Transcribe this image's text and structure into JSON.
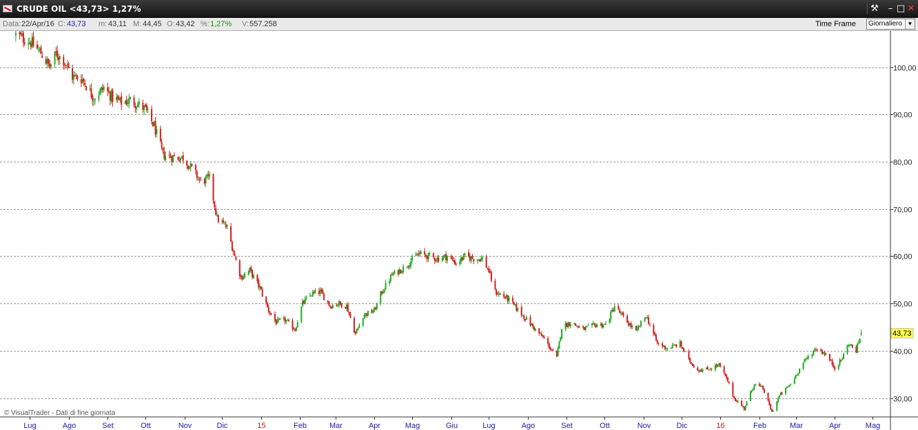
{
  "window": {
    "title": "CRUDE OIL <43,73> 1,27%",
    "pin_icon": "pin-icon",
    "minimize_icon": "minimize-icon",
    "maximize_icon": "maximize-icon",
    "close_icon": "close-icon"
  },
  "infobar": {
    "date_label": "Data:",
    "date_value": "22/Apr/16",
    "close_label": "C:",
    "close_value": "43,73",
    "min_label": "m:",
    "min_value": "43,11",
    "max_label": "M:",
    "max_value": "44,45",
    "open_label": "O:",
    "open_value": "43,42",
    "pct_label": "%:",
    "pct_value": "1,27%",
    "vol_label": "V:",
    "vol_value": "557.258",
    "timeframe_label": "Time Frame",
    "timeframe_value": "Giornaliero"
  },
  "credit": "© VisualTrader - Dati di fine giornata",
  "colors": {
    "up_candle": "#1fa81f",
    "down_candle": "#d41b1b",
    "gridline": "#9a9a9a",
    "month_label": "#1a1aa8",
    "year_label": "#cc1111",
    "last_price_bg": "#ffff55"
  },
  "chart_data": {
    "type": "candlestick",
    "series_name": "CRUDE OIL",
    "timeframe": "Giornaliero",
    "y_ticks": [
      "30,00",
      "40,00",
      "50,00",
      "60,00",
      "70,00",
      "80,00",
      "90,00",
      "100,00"
    ],
    "y_tick_values": [
      30,
      40,
      50,
      60,
      70,
      80,
      90,
      100
    ],
    "ylim": [
      26,
      107.5
    ],
    "x_ticks": [
      {
        "label": "Lug",
        "date": "2014-07-01"
      },
      {
        "label": "Ago",
        "date": "2014-08-01"
      },
      {
        "label": "Set",
        "date": "2014-09-01"
      },
      {
        "label": "Ott",
        "date": "2014-10-01"
      },
      {
        "label": "Nov",
        "date": "2014-11-01"
      },
      {
        "label": "Dic",
        "date": "2014-12-01"
      },
      {
        "label": "15",
        "date": "2015-01-01",
        "year": true
      },
      {
        "label": "Feb",
        "date": "2015-02-01"
      },
      {
        "label": "Mar",
        "date": "2015-03-01"
      },
      {
        "label": "Apr",
        "date": "2015-04-01"
      },
      {
        "label": "Mag",
        "date": "2015-05-01"
      },
      {
        "label": "Giu",
        "date": "2015-06-01"
      },
      {
        "label": "Lug",
        "date": "2015-07-01"
      },
      {
        "label": "Ago",
        "date": "2015-08-01"
      },
      {
        "label": "Set",
        "date": "2015-09-01"
      },
      {
        "label": "Ott",
        "date": "2015-10-01"
      },
      {
        "label": "Nov",
        "date": "2015-11-01"
      },
      {
        "label": "Dic",
        "date": "2015-12-01"
      },
      {
        "label": "16",
        "date": "2016-01-01",
        "year": true
      },
      {
        "label": "Feb",
        "date": "2016-02-01"
      },
      {
        "label": "Mar",
        "date": "2016-03-01"
      },
      {
        "label": "Apr",
        "date": "2016-04-01"
      },
      {
        "label": "Mag",
        "date": "2016-05-01"
      }
    ],
    "close_path": [
      [
        "2014-06-20",
        106.8
      ],
      [
        "2014-07-01",
        105.5
      ],
      [
        "2014-07-10",
        103.0
      ],
      [
        "2014-07-17",
        100.0
      ],
      [
        "2014-07-22",
        102.8
      ],
      [
        "2014-07-28",
        101.5
      ],
      [
        "2014-08-04",
        98.0
      ],
      [
        "2014-08-12",
        97.5
      ],
      [
        "2014-08-21",
        93.5
      ],
      [
        "2014-08-29",
        95.6
      ],
      [
        "2014-09-05",
        93.5
      ],
      [
        "2014-09-12",
        92.5
      ],
      [
        "2014-09-19",
        93.0
      ],
      [
        "2014-09-26",
        92.0
      ],
      [
        "2014-10-01",
        91.0
      ],
      [
        "2014-10-08",
        87.5
      ],
      [
        "2014-10-15",
        81.5
      ],
      [
        "2014-10-22",
        81.0
      ],
      [
        "2014-10-31",
        80.8
      ],
      [
        "2014-11-07",
        78.5
      ],
      [
        "2014-11-14",
        75.8
      ],
      [
        "2014-11-21",
        76.5
      ],
      [
        "2014-11-27",
        68.0
      ],
      [
        "2014-12-05",
        66.0
      ],
      [
        "2014-12-11",
        60.0
      ],
      [
        "2014-12-16",
        55.5
      ],
      [
        "2014-12-23",
        57.0
      ],
      [
        "2014-12-31",
        53.3
      ],
      [
        "2015-01-07",
        48.5
      ],
      [
        "2015-01-13",
        46.0
      ],
      [
        "2015-01-20",
        46.5
      ],
      [
        "2015-01-28",
        44.5
      ],
      [
        "2015-02-03",
        50.0
      ],
      [
        "2015-02-10",
        52.0
      ],
      [
        "2015-02-17",
        52.5
      ],
      [
        "2015-02-25",
        49.5
      ],
      [
        "2015-03-03",
        50.0
      ],
      [
        "2015-03-10",
        49.5
      ],
      [
        "2015-03-17",
        43.5
      ],
      [
        "2015-03-23",
        47.5
      ],
      [
        "2015-04-01",
        48.5
      ],
      [
        "2015-04-07",
        52.5
      ],
      [
        "2015-04-15",
        56.0
      ],
      [
        "2015-04-24",
        57.5
      ],
      [
        "2015-05-06",
        60.5
      ],
      [
        "2015-05-14",
        60.0
      ],
      [
        "2015-05-21",
        59.5
      ],
      [
        "2015-05-29",
        60.0
      ],
      [
        "2015-06-05",
        58.5
      ],
      [
        "2015-06-12",
        60.0
      ],
      [
        "2015-06-19",
        59.5
      ],
      [
        "2015-06-26",
        59.5
      ],
      [
        "2015-07-01",
        56.8
      ],
      [
        "2015-07-06",
        52.5
      ],
      [
        "2015-07-16",
        51.0
      ],
      [
        "2015-07-28",
        47.5
      ],
      [
        "2015-08-07",
        44.5
      ],
      [
        "2015-08-14",
        42.5
      ],
      [
        "2015-08-24",
        38.5
      ],
      [
        "2015-08-28",
        45.0
      ],
      [
        "2015-09-04",
        46.0
      ],
      [
        "2015-09-14",
        44.5
      ],
      [
        "2015-09-24",
        45.5
      ],
      [
        "2015-10-02",
        45.5
      ],
      [
        "2015-10-09",
        49.5
      ],
      [
        "2015-10-16",
        47.0
      ],
      [
        "2015-10-26",
        44.0
      ],
      [
        "2015-11-03",
        47.5
      ],
      [
        "2015-11-12",
        41.5
      ],
      [
        "2015-11-20",
        40.5
      ],
      [
        "2015-11-30",
        41.5
      ],
      [
        "2015-12-07",
        38.0
      ],
      [
        "2015-12-14",
        36.0
      ],
      [
        "2015-12-21",
        36.0
      ],
      [
        "2015-12-31",
        37.0
      ],
      [
        "2016-01-07",
        33.5
      ],
      [
        "2016-01-12",
        30.0
      ],
      [
        "2016-01-20",
        27.8
      ],
      [
        "2016-01-28",
        33.0
      ],
      [
        "2016-02-04",
        32.0
      ],
      [
        "2016-02-11",
        27.0
      ],
      [
        "2016-02-17",
        30.5
      ],
      [
        "2016-02-26",
        33.0
      ],
      [
        "2016-03-07",
        37.5
      ],
      [
        "2016-03-17",
        40.5
      ],
      [
        "2016-03-24",
        39.5
      ],
      [
        "2016-04-01",
        36.5
      ],
      [
        "2016-04-06",
        38.0
      ],
      [
        "2016-04-12",
        41.5
      ],
      [
        "2016-04-18",
        40.0
      ],
      [
        "2016-04-22",
        43.73
      ]
    ],
    "last_price": 43.73,
    "last_price_label": "43,73",
    "last_bar": {
      "date": "2016-04-22",
      "open": 43.42,
      "high": 44.45,
      "low": 43.11,
      "close": 43.73,
      "volume": 557258
    }
  }
}
